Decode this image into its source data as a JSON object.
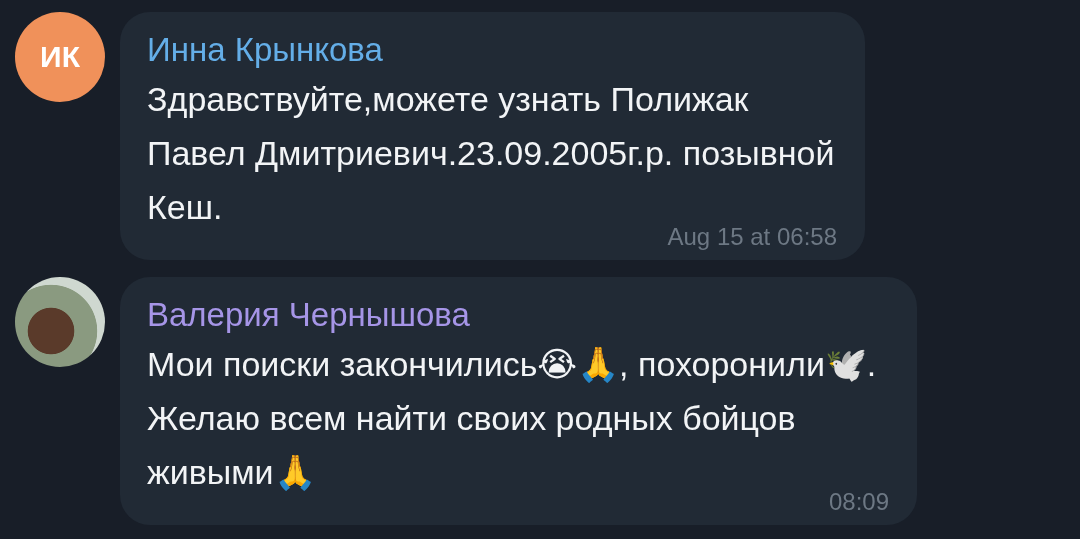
{
  "messages": [
    {
      "avatar": {
        "kind": "initials",
        "text": "ИК",
        "color": "#f0915a"
      },
      "author": "Инна Крынкова",
      "color": "#64aee8",
      "text": "Здравствуйте,можете узнать Полижак Павел Дмитриевич.23.09.2005г.р. позывной Кеш.",
      "time": "Aug 15 at 06:58"
    },
    {
      "avatar": {
        "kind": "photo"
      },
      "author": "Валерия Чернышова",
      "color": "#a695e7",
      "text": "Мои поиски закончились😭🙏, похоронили🕊️. Желаю всем найти своих родных бойцов живыми🙏",
      "time": "08:09"
    }
  ]
}
